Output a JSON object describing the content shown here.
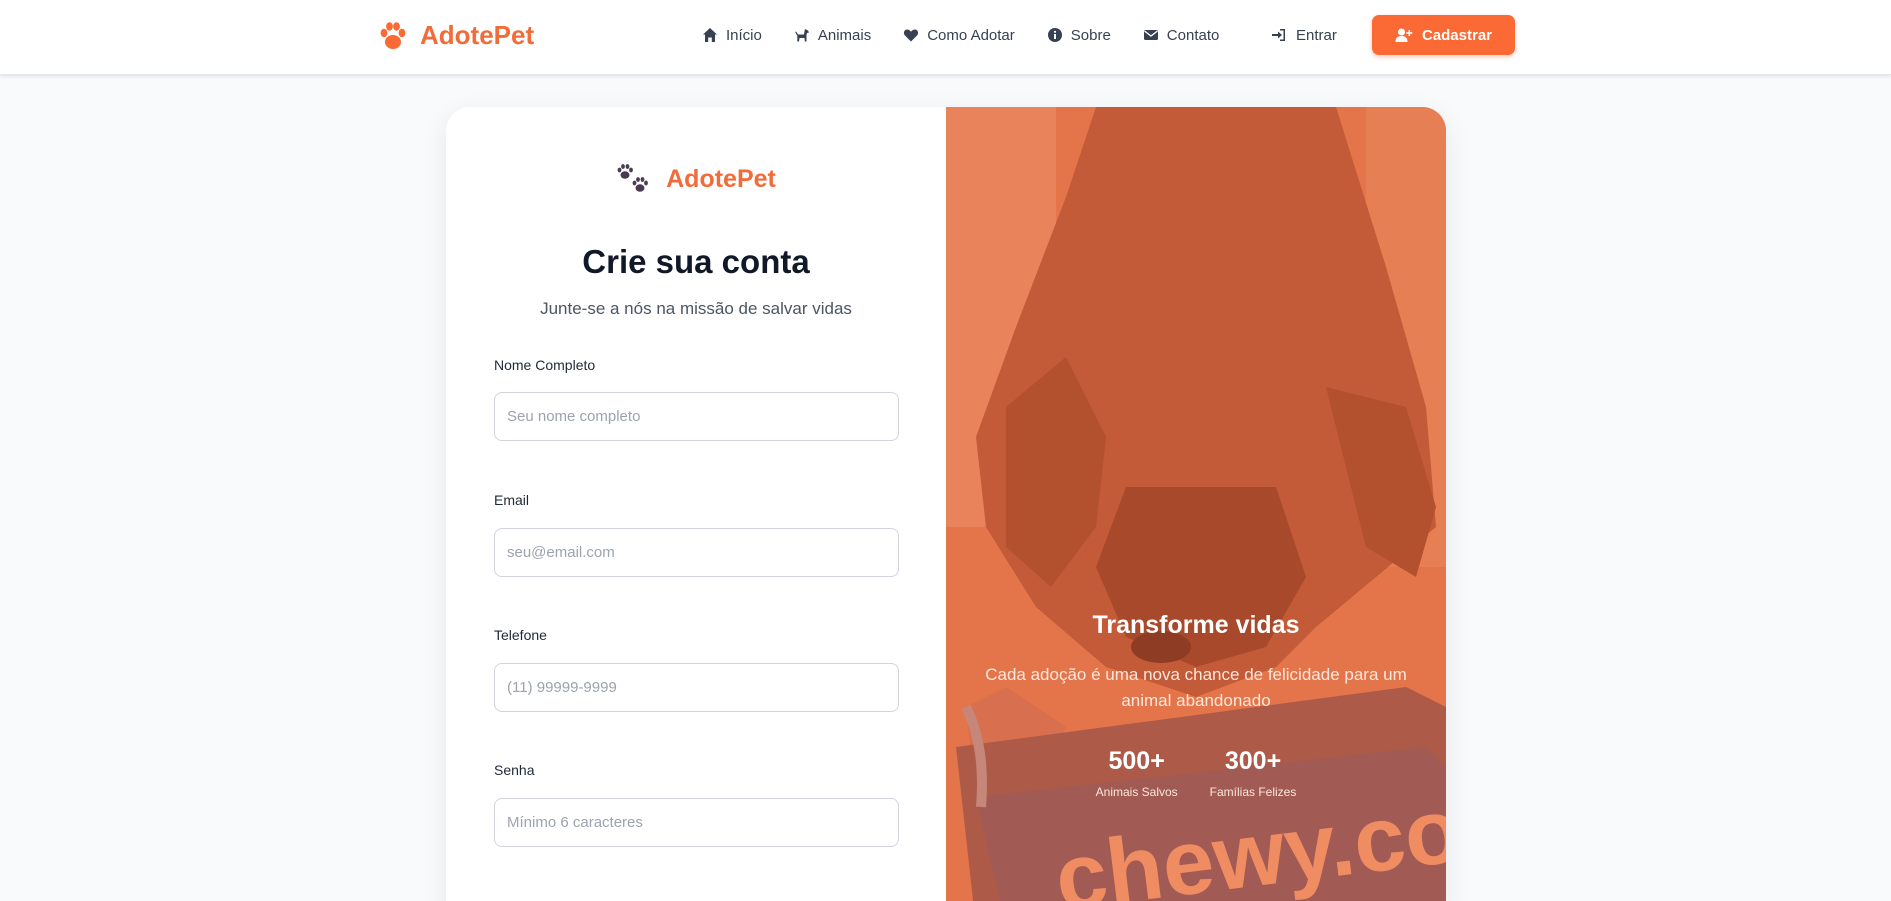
{
  "header": {
    "brand": "AdotePet",
    "nav": [
      {
        "label": "Início",
        "icon": "home-icon"
      },
      {
        "label": "Animais",
        "icon": "dog-icon"
      },
      {
        "label": "Como Adotar",
        "icon": "heart-icon"
      },
      {
        "label": "Sobre",
        "icon": "info-icon"
      },
      {
        "label": "Contato",
        "icon": "envelope-icon"
      }
    ],
    "login_label": "Entrar",
    "signup_label": "Cadastrar"
  },
  "form": {
    "brand": "AdotePet",
    "title": "Crie sua conta",
    "subtitle": "Junte-se a nós na missão de salvar vidas",
    "fields": [
      {
        "label": "Nome Completo",
        "placeholder": "Seu nome completo",
        "value": ""
      },
      {
        "label": "Email",
        "placeholder": "seu@email.com",
        "value": ""
      },
      {
        "label": "Telefone",
        "placeholder": "(11) 99999-9999",
        "value": ""
      },
      {
        "label": "Senha",
        "placeholder": "Mínimo 6 caracteres",
        "value": ""
      }
    ]
  },
  "promo": {
    "title": "Transforme vidas",
    "text": "Cada adoção é uma nova chance de felicidade para um animal abandonado",
    "stats": [
      {
        "value": "500+",
        "label": "Animais Salvos"
      },
      {
        "value": "300+",
        "label": "Famílias Felizes"
      }
    ],
    "image_text": "chewy.com"
  },
  "colors": {
    "accent": "#fb6a34",
    "brand": "#f26b3a",
    "overlay": "#e0683d"
  }
}
